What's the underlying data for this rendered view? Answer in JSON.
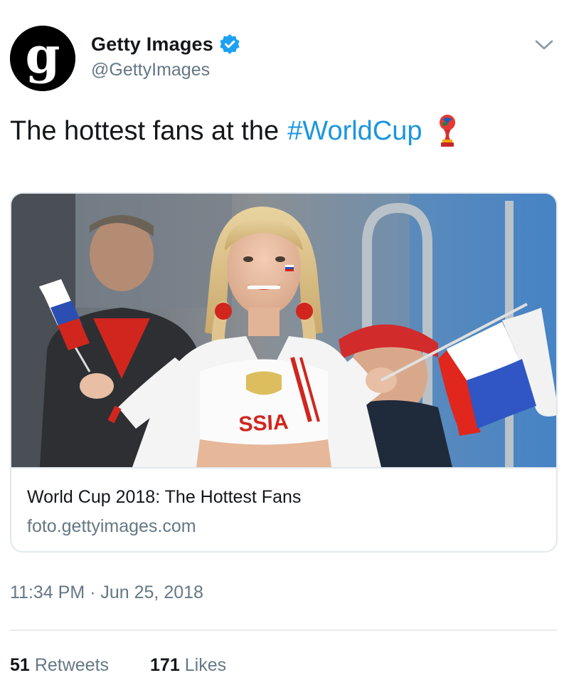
{
  "author": {
    "display_name": "Getty Images",
    "handle": "@GettyImages",
    "avatar_letter": "g",
    "verified": true
  },
  "tweet": {
    "text": "The hottest fans at the",
    "hashtag": "#WorldCup",
    "emoji": "world-cup-trophy"
  },
  "card": {
    "title": "World Cup 2018: The Hottest Fans",
    "domain": "foto.gettyimages.com",
    "image_shirt_text": "SSIA"
  },
  "meta": {
    "timestamp": "11:34 PM · Jun 25, 2018"
  },
  "stats": {
    "retweets_count": "51",
    "retweets_label": "Retweets",
    "likes_count": "171",
    "likes_label": "Likes"
  },
  "colors": {
    "link": "#1b95e0",
    "secondary_text": "#657786",
    "border": "#e1e8ed",
    "verified_badge": "#1da1f2"
  }
}
